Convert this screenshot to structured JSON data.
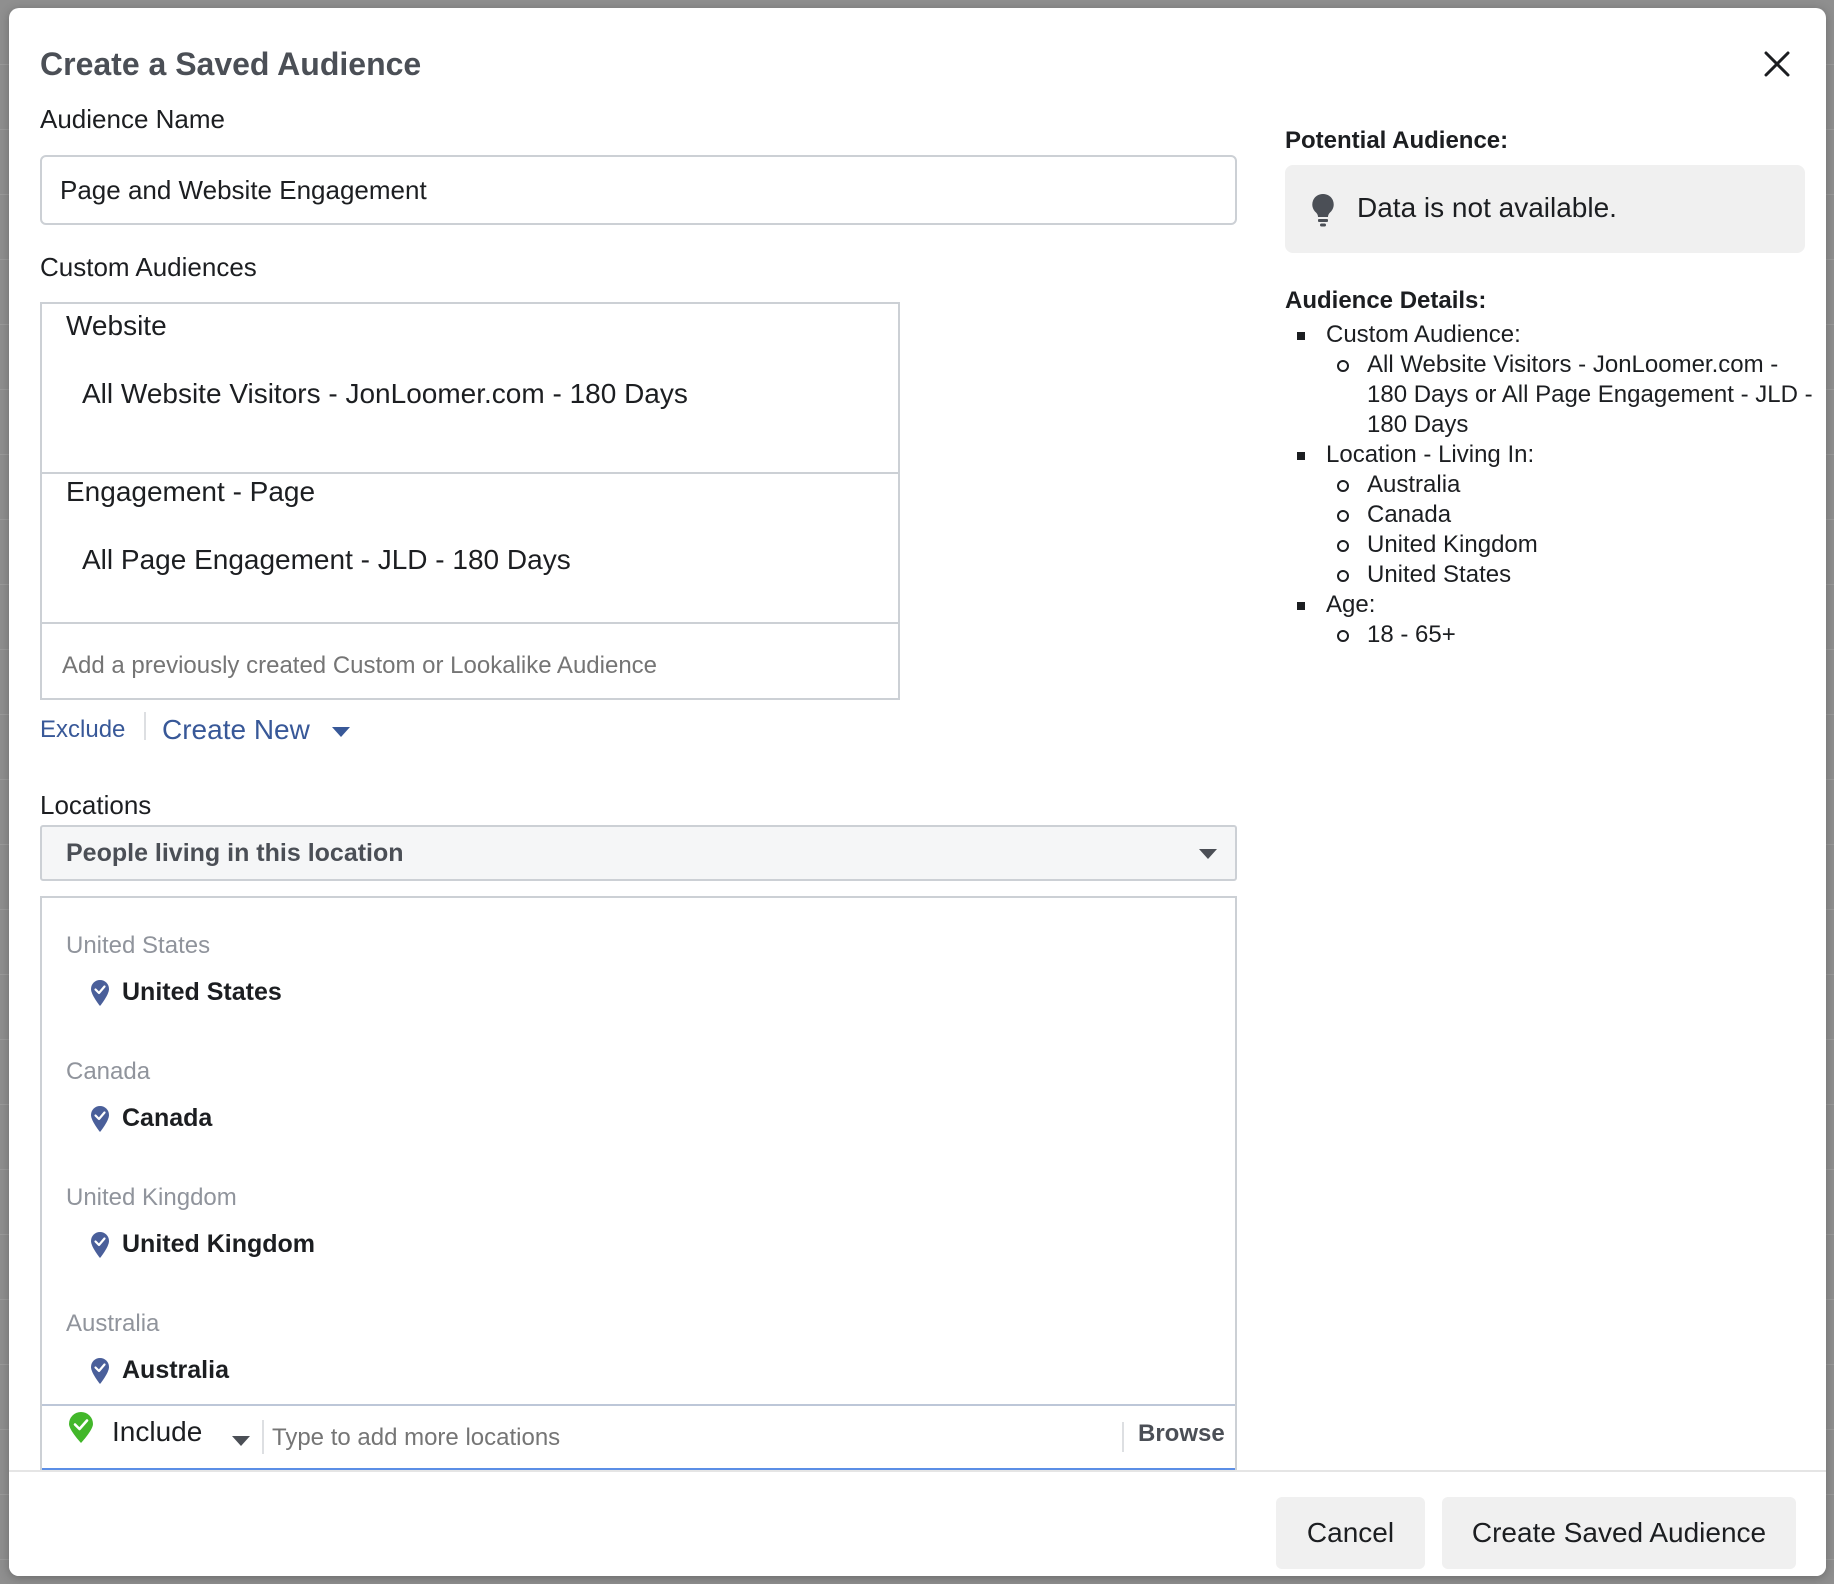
{
  "modal": {
    "title": "Create a Saved Audience",
    "close_icon": "close-icon"
  },
  "audience_name": {
    "label": "Audience Name",
    "value": "Page and Website Engagement"
  },
  "custom_audiences": {
    "label": "Custom Audiences",
    "groups": [
      {
        "title": "Website",
        "items": [
          "All Website Visitors - JonLoomer.com - 180 Days"
        ]
      },
      {
        "title": "Engagement - Page",
        "items": [
          "All Page Engagement - JLD - 180 Days"
        ]
      }
    ],
    "add_placeholder": "Add a previously created Custom or Lookalike Audience",
    "exclude_label": "Exclude",
    "create_new_label": "Create New"
  },
  "locations": {
    "label": "Locations",
    "selected_type": "People living in this location",
    "entries": [
      {
        "group": "United States",
        "name": "United States"
      },
      {
        "group": "Canada",
        "name": "Canada"
      },
      {
        "group": "United Kingdom",
        "name": "United Kingdom"
      },
      {
        "group": "Australia",
        "name": "Australia"
      }
    ],
    "include_label": "Include",
    "input_placeholder": "Type to add more locations",
    "browse_label": "Browse"
  },
  "potential_audience": {
    "title": "Potential Audience:",
    "message": "Data is not available.",
    "icon": "lightbulb-icon"
  },
  "audience_details": {
    "title": "Audience Details:",
    "sections": [
      {
        "label": "Custom Audience:",
        "items": [
          "All Website Visitors - JonLoomer.com - 180 Days or All Page Engagement - JLD - 180 Days"
        ]
      },
      {
        "label": "Location - Living In:",
        "items": [
          "Australia",
          "Canada",
          "United Kingdom",
          "United States"
        ]
      },
      {
        "label": "Age:",
        "items": [
          "18 - 65+"
        ]
      }
    ]
  },
  "footer": {
    "cancel_label": "Cancel",
    "create_label": "Create Saved Audience"
  },
  "colors": {
    "link": "#385898",
    "pin": "#4a5f9a",
    "include_check": "#42b72a",
    "map": "#5b8ee6"
  }
}
